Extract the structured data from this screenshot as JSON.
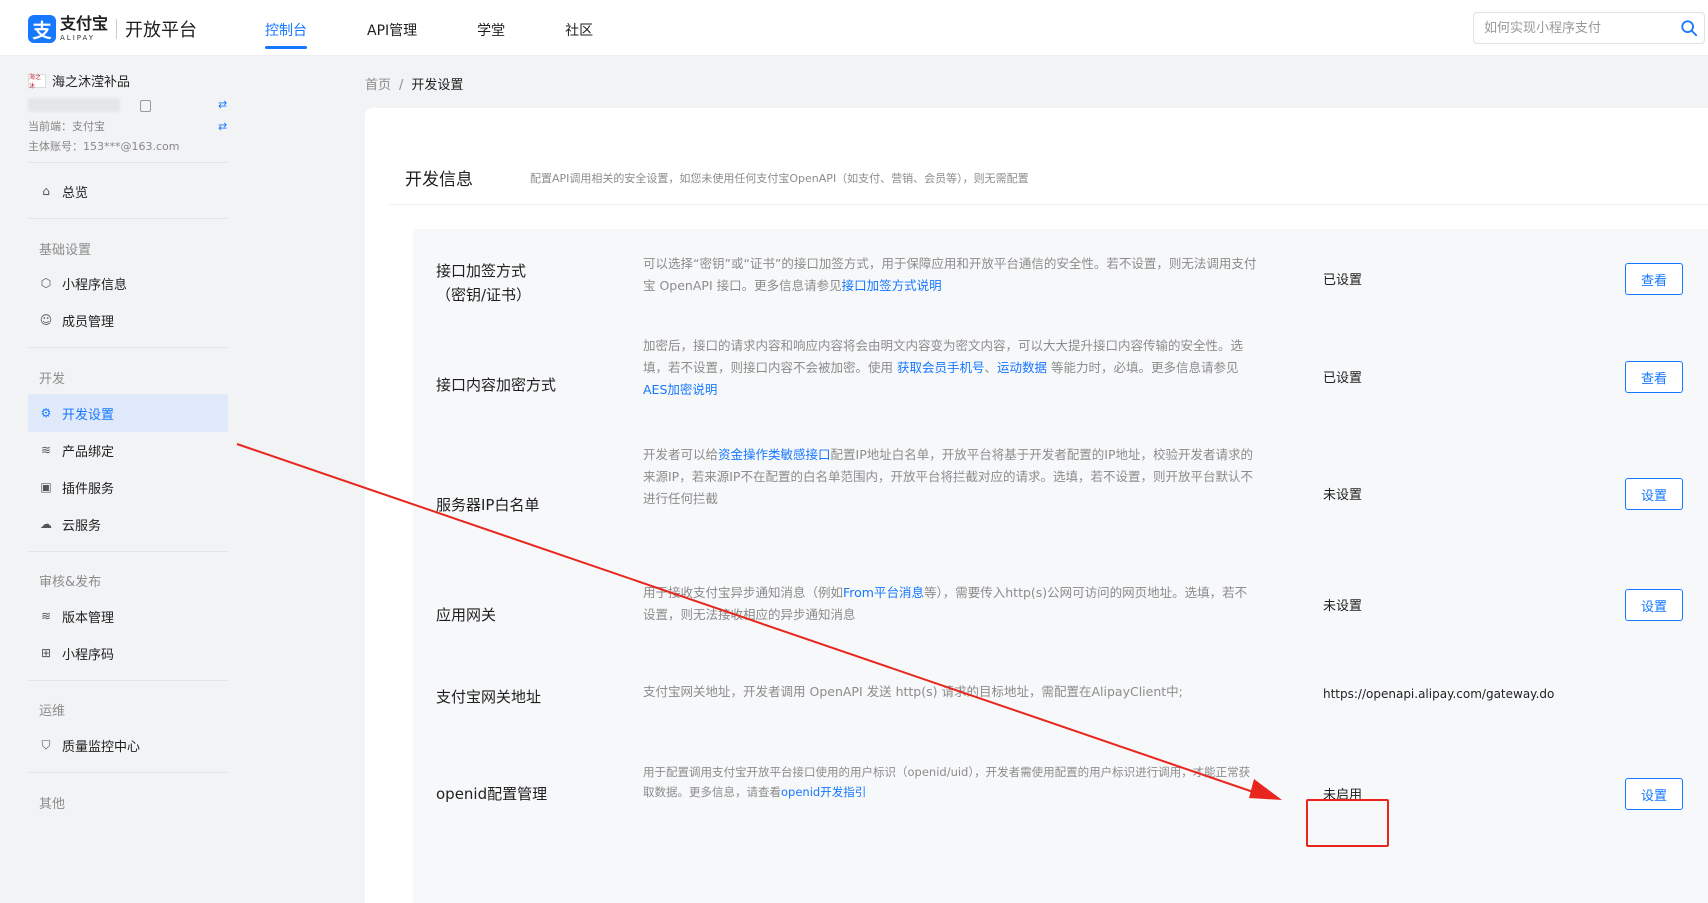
{
  "header": {
    "logo_cn": "支付宝",
    "logo_en": "ALIPAY",
    "logo_mark": "支",
    "platform": "开放平台",
    "nav": [
      "控制台",
      "API管理",
      "学堂",
      "社区"
    ],
    "search_placeholder": "如何实现小程序支付"
  },
  "account": {
    "avatar_text": "海之沐",
    "name": "海之沐滢补品",
    "current_end": "当前端：支付宝",
    "main_account": "主体账号：153***@163.com",
    "swap_symbol": "⇄"
  },
  "sidebar": {
    "overview": "总览",
    "groups": [
      {
        "title": "基础设置",
        "items": [
          "小程序信息",
          "成员管理"
        ]
      },
      {
        "title": "开发",
        "items": [
          "开发设置",
          "产品绑定",
          "插件服务",
          "云服务"
        ]
      },
      {
        "title": "审核&发布",
        "items": [
          "版本管理",
          "小程序码"
        ]
      },
      {
        "title": "运维",
        "items": [
          "质量监控中心"
        ]
      },
      {
        "title": "其他",
        "items": []
      }
    ]
  },
  "breadcrumb": {
    "home": "首页",
    "sep": "/",
    "current": "开发设置"
  },
  "panel": {
    "title": "开发信息",
    "subtitle": "配置API调用相关的安全设置，如您未使用任何支付宝OpenAPI（如支付、营销、会员等），则无需配置"
  },
  "rows": [
    {
      "name": [
        "接口加签方式",
        "（密钥/证书）"
      ],
      "desc": [
        {
          "t": "可以选择“密钥”或“证书”的接口加签方式，用于保障应用和开放平台通信的安全性。若不设置，则无法调用支付宝 OpenAPI 接口。更多信息请参见"
        },
        {
          "t": "接口加签方式说明",
          "link": true
        }
      ],
      "status": "已设置",
      "button": "查看"
    },
    {
      "name": [
        "接口内容加密方式"
      ],
      "desc": [
        {
          "t": "加密后，接口的请求内容和响应内容将会由明文内容变为密文内容，可以大大提升接口内容传输的安全性。选填，若不设置，则接口内容不会被加密。使用 "
        },
        {
          "t": "获取会员手机号",
          "link": true
        },
        {
          "t": "、"
        },
        {
          "t": "运动数据",
          "link": true
        },
        {
          "t": " 等能力时，必填。更多信息请参见"
        },
        {
          "t": "AES加密说明",
          "link": true
        }
      ],
      "status": "已设置",
      "button": "查看"
    },
    {
      "name": [
        "服务器IP白名单"
      ],
      "desc": [
        {
          "t": "开发者可以给"
        },
        {
          "t": "资金操作类敏感接口",
          "link": true
        },
        {
          "t": "配置IP地址白名单，开放平台将基于开发者配置的IP地址，校验开发者请求的来源IP，若来源IP不在配置的白名单范围内，开放平台将拦截对应的请求。选填，若不设置，则开放平台默认不进行任何拦截"
        }
      ],
      "status": "未设置",
      "button": "设置"
    },
    {
      "name": [
        "应用网关"
      ],
      "desc": [
        {
          "t": "用于接收支付宝异步通知消息（例如"
        },
        {
          "t": "From平台消息",
          "link": true
        },
        {
          "t": "等），需要传入http(s)公网可访问的网页地址。选填，若不设置，则无法接收相应的异步通知消息"
        }
      ],
      "status": "未设置",
      "button": "设置"
    },
    {
      "name": [
        "支付宝网关地址"
      ],
      "desc": [
        {
          "t": "支付宝网关地址，开发者调用 OpenAPI 发送 http(s) 请求的目标地址，需配置在AlipayClient中;"
        }
      ],
      "status": "https://openapi.alipay.com/gateway.do",
      "button": ""
    },
    {
      "name": [
        "openid配置管理"
      ],
      "desc": [
        {
          "t": "用于配置调用支付宝开放平台接口使用的用户标识（openid/uid），开发者需使用配置的用户标识进行调用，才能正常获取数据。更多信息，请查看"
        },
        {
          "t": "openid开发指引",
          "link": true
        }
      ],
      "status": "未启用",
      "button": "设置"
    }
  ],
  "colors": {
    "accent": "#1677ff",
    "annotation": "#e8261d"
  }
}
